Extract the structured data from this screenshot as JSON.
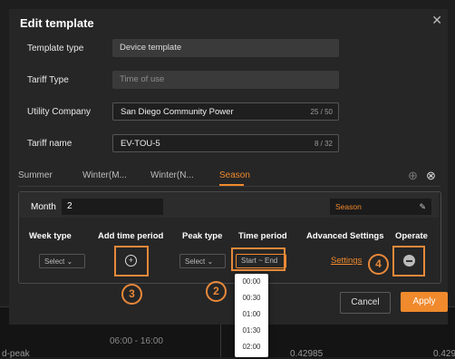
{
  "modal": {
    "title": "Edit template",
    "close_icon": "close-icon",
    "fields": {
      "template_type": {
        "label": "Template type",
        "value": "Device template"
      },
      "tariff_type": {
        "label": "Tariff Type",
        "value": "Time of use"
      },
      "utility_company": {
        "label": "Utility Company",
        "value": "San Diego Community Power",
        "count": "25 / 50"
      },
      "tariff_name": {
        "label": "Tariff name",
        "value": "EV-TOU-5",
        "count": "8 / 32"
      }
    },
    "tabs": [
      "Summer",
      "Winter(M...",
      "Winter(N...",
      "Season"
    ],
    "active_tab": "Season",
    "add_tab_icon": "plus-circle-icon",
    "remove_tab_icon": "x-circle-icon",
    "month_label": "Month",
    "month_value": "2",
    "season_value": "Season",
    "columns": [
      "Week type",
      "Add time period",
      "Peak type",
      "Time period",
      "Advanced Settings",
      "Operate"
    ],
    "row": {
      "week_type": "Select",
      "peak_type": "Select",
      "time_period": "Start ~ End",
      "settings": "Settings"
    },
    "buttons": {
      "cancel": "Cancel",
      "apply": "Apply"
    },
    "time_options": [
      "00:00",
      "00:30",
      "01:00",
      "01:30",
      "02:00"
    ]
  },
  "annotations": [
    "3",
    "2",
    "4"
  ],
  "background": {
    "time": "06:00 - 16:00",
    "label": "d-peak",
    "value1": "0.42985",
    "value2": "0.429"
  },
  "colors": {
    "accent": "#f08a2c",
    "modal_bg": "#262626"
  }
}
